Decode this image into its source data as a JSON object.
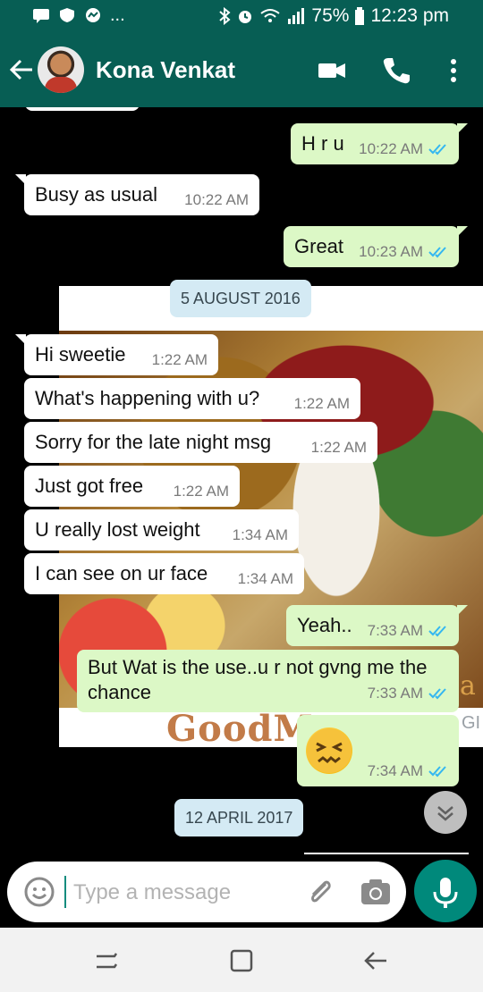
{
  "status_bar": {
    "battery": "75%",
    "time": "12:23 pm",
    "dots": "..."
  },
  "header": {
    "contact_name": "Kona Venkat"
  },
  "colors": {
    "accent": "#075e54",
    "in_bubble": "#ffffff",
    "out_bubble": "#dcf8c6",
    "tick": "#34b7f1",
    "mic": "#00897b"
  },
  "messages": [
    {
      "text": "H r u",
      "time": "10:22 AM",
      "dir": "out",
      "read": true
    },
    {
      "text": "Busy as usual",
      "time": "10:22 AM",
      "dir": "in"
    },
    {
      "text": "Great",
      "time": "10:23 AM",
      "dir": "out",
      "read": true
    },
    {
      "date_chip": "5 AUGUST 2016"
    },
    {
      "text": "Hi sweetie",
      "time": "1:22 AM",
      "dir": "in"
    },
    {
      "text": "What's happening with u?",
      "time": "1:22 AM",
      "dir": "in"
    },
    {
      "text": "Sorry for the late night msg",
      "time": "1:22 AM",
      "dir": "in"
    },
    {
      "text": "Just got free",
      "time": "1:22 AM",
      "dir": "in"
    },
    {
      "text": "U really lost weight",
      "time": "1:34 AM",
      "dir": "in"
    },
    {
      "text": "I can see on ur face",
      "time": "1:34 AM",
      "dir": "in"
    },
    {
      "text": "Yeah..",
      "time": "7:33 AM",
      "dir": "out",
      "read": true
    },
    {
      "text": "But Wat is the use..u r not gvng me the chance",
      "time": "7:33 AM",
      "dir": "out",
      "read": true
    },
    {
      "emoji": "confounded-face",
      "time": "7:34 AM",
      "dir": "out",
      "read": true
    },
    {
      "date_chip": "12 APRIL 2017"
    }
  ],
  "photo": {
    "caption_text": "GoodM",
    "corner_text_a": "a",
    "corner_text_b": "GI"
  },
  "input": {
    "placeholder": "Type a message"
  }
}
